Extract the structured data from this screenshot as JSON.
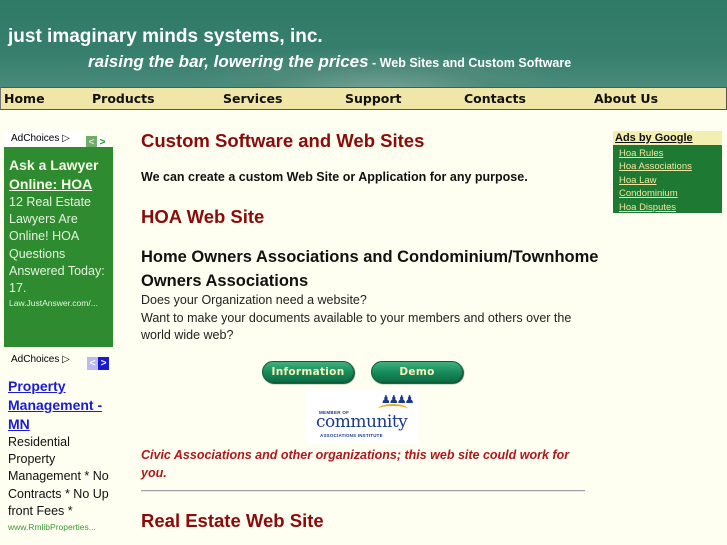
{
  "header": {
    "company": "just imaginary minds systems, inc.",
    "slogan": "raising the bar, lowering the prices",
    "subtitle": " - Web Sites and Custom Software"
  },
  "nav": [
    {
      "label": "Home"
    },
    {
      "label": "Products"
    },
    {
      "label": "Services"
    },
    {
      "label": "Support"
    },
    {
      "label": "Contacts"
    },
    {
      "label": "About Us"
    }
  ],
  "left_ads": [
    {
      "adchoices": "AdChoices",
      "title_line1": "Ask a Lawyer",
      "title_line2": "Online: HOA",
      "description": "12 Real Estate Lawyers Are Online! HOA Questions Answered Today: 17.",
      "url": "Law.JustAnswer.com/...",
      "bg_color": "#2e8b2f"
    },
    {
      "adchoices": "AdChoices",
      "title": "Property Management - MN",
      "description": "Residential Property Management * No Contracts * No Up front Fees *",
      "url": "www.RmlibProperties..."
    }
  ],
  "main": {
    "heading": "Custom Software and Web Sites",
    "intro": "We can create a custom Web Site or Application for any purpose.",
    "hoa_heading": "HOA Web Site",
    "hoa_subheading": "Home Owners Associations and Condominium/Townhome Owners Associations",
    "hoa_paragraph_line1": "Does your Organization need a website?",
    "hoa_paragraph_line2": "Want to make your documents available to your members and others over the world wide web?",
    "buttons": {
      "information": "Information",
      "demo": "Demo"
    },
    "logo": {
      "member_of": "MEMBER OF",
      "community": "community",
      "institute": "ASSOCIATIONS INSTITUTE"
    },
    "civic_note": "Civic Associations and other organizations; this web site could work for you.",
    "real_estate_heading": "Real Estate Web Site"
  },
  "right_ads": {
    "header": "Ads by Google",
    "links": [
      "Hoa Rules",
      "Hoa Associations",
      "Hoa Law",
      "Condominium",
      "Hoa Disputes"
    ]
  },
  "colors": {
    "heading_red": "#8b0a0a",
    "civic_red": "#b2161c",
    "nav_bg": "#f0e6a8",
    "banner_green": "#367f6d",
    "page_bg": "#fefff0"
  }
}
